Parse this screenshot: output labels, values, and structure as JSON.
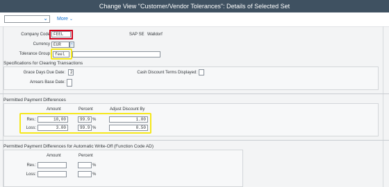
{
  "window": {
    "title": "Change View \"Customer/Vendor Tolerances\": Details of Selected Set"
  },
  "toolbar": {
    "more_label": "More"
  },
  "header": {
    "company_code_label": "Company Code",
    "company_code_value": "FEEL",
    "company_name": "SAP SE",
    "city": "Walldorf",
    "currency_label": "Currency",
    "currency_value": "EUR",
    "tolerance_group_label": "Tolerance Group",
    "tolerance_group_value": "feel"
  },
  "clearing": {
    "title": "Specifications for Clearing Transactions",
    "grace_days_label": "Grace Days Due Date:",
    "grace_days_value": "2",
    "cash_discount_label": "Cash Discount Terms Displayed:",
    "cash_discount_value": "",
    "arrears_label": "Arrears Base Date:",
    "arrears_value": ""
  },
  "permitted": {
    "title": "Permitted Payment Differences",
    "columns": [
      "Amount",
      "Percent",
      "Adjust Discount By"
    ],
    "rows": [
      {
        "label": "Rev.:",
        "amount": "10,00",
        "percent": "99.9",
        "pct_sign": "%",
        "adjust": "1.00"
      },
      {
        "label": "Loss:",
        "amount": "3.00",
        "percent": "99.9",
        "pct_sign": "%",
        "adjust": "0.50"
      }
    ]
  },
  "writeoff": {
    "title": "Permitted Payment Differences for Automatic Write-Off (Function Code AD)",
    "columns": [
      "Amount",
      "Percent"
    ],
    "rows": [
      {
        "label": "Rev.:",
        "amount": "",
        "percent": "",
        "pct_sign": "%"
      },
      {
        "label": "Loss:",
        "amount": "",
        "percent": "",
        "pct_sign": "%"
      }
    ]
  },
  "colors": {
    "title_bar": "#3f5161",
    "link": "#0a6ed1",
    "highlight_red": "#d0021b",
    "highlight_yellow": "#f5e71a"
  }
}
